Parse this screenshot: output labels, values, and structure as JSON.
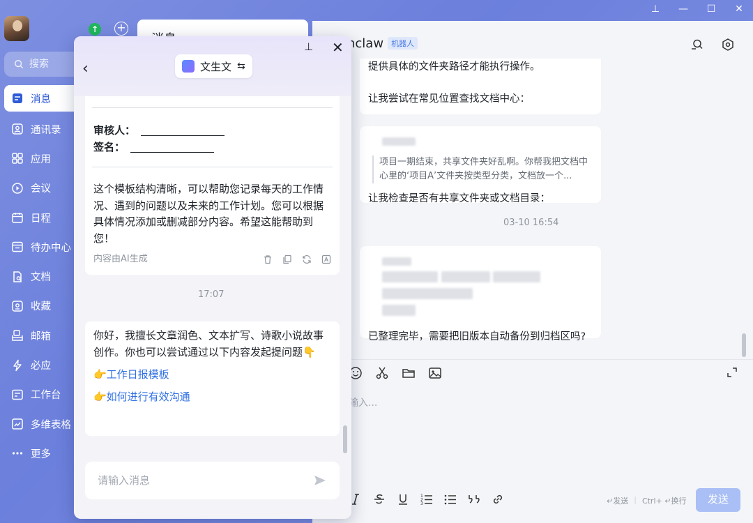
{
  "sidebar": {
    "search_label": "搜索",
    "items": [
      {
        "label": "消息",
        "icon": "message-icon"
      },
      {
        "label": "通讯录",
        "icon": "contacts-icon"
      },
      {
        "label": "应用",
        "icon": "apps-icon"
      },
      {
        "label": "会议",
        "icon": "meeting-icon"
      },
      {
        "label": "日程",
        "icon": "calendar-icon"
      },
      {
        "label": "待办中心",
        "icon": "todo-icon"
      },
      {
        "label": "文档",
        "icon": "docs-icon"
      },
      {
        "label": "收藏",
        "icon": "bookmark-icon"
      },
      {
        "label": "邮箱",
        "icon": "mail-icon"
      },
      {
        "label": "必应",
        "icon": "bolt-icon"
      },
      {
        "label": "工作台",
        "icon": "workbench-icon"
      },
      {
        "label": "多维表格",
        "icon": "table-icon"
      },
      {
        "label": "更多",
        "icon": "more-icon"
      }
    ]
  },
  "list_tab": {
    "title": "消息"
  },
  "chat": {
    "name": "nclaw",
    "bot_tag": "机器人",
    "msg1_line1": "提供具体的文件夹路径才能执行操作。",
    "msg1_line2": "让我尝试在常见位置查找文档中心：",
    "quote_text": "项目一期结束，共享文件夹好乱啊。你帮我把文档中心里的‘项目A’文件夹按类型分类，文档放一个...",
    "msg2_text": "让我检查是否有共享文件夹或文档目录：",
    "timestamp": "03-10 16:54",
    "msg3_text": "已整理完毕，需要把旧版本自动备份到归档区吗?",
    "composer_placeholder": "输入...",
    "hint_send": "↵发送",
    "hint_newline": "Ctrl+ ↵换行",
    "send_label": "发送"
  },
  "panel": {
    "mode_label": "文生文",
    "reviewer_label": "审核人：",
    "sign_label": "签名：",
    "ai_reply": "这个模板结构清晰，可以帮助您记录每天的工作情况、遇到的问题以及未来的工作计划。您可以根据具体情况添加或删减部分内容。希望这能帮助到您！",
    "ai_generated_note": "内容由AI生成",
    "time": "17:07",
    "intro": "你好，我擅长文章润色、文本扩写、诗歌小说故事创作。你也可以尝试通过以下内容发起提问题👇",
    "suggestions": [
      "👉工作日报模板",
      "👉如何进行有效沟通"
    ],
    "input_placeholder": "请输入消息"
  },
  "colors": {
    "accent": "#2f5bd6",
    "link": "#2f6fe4",
    "send_disabled": "#a9bff5",
    "online": "#1fb85b"
  }
}
